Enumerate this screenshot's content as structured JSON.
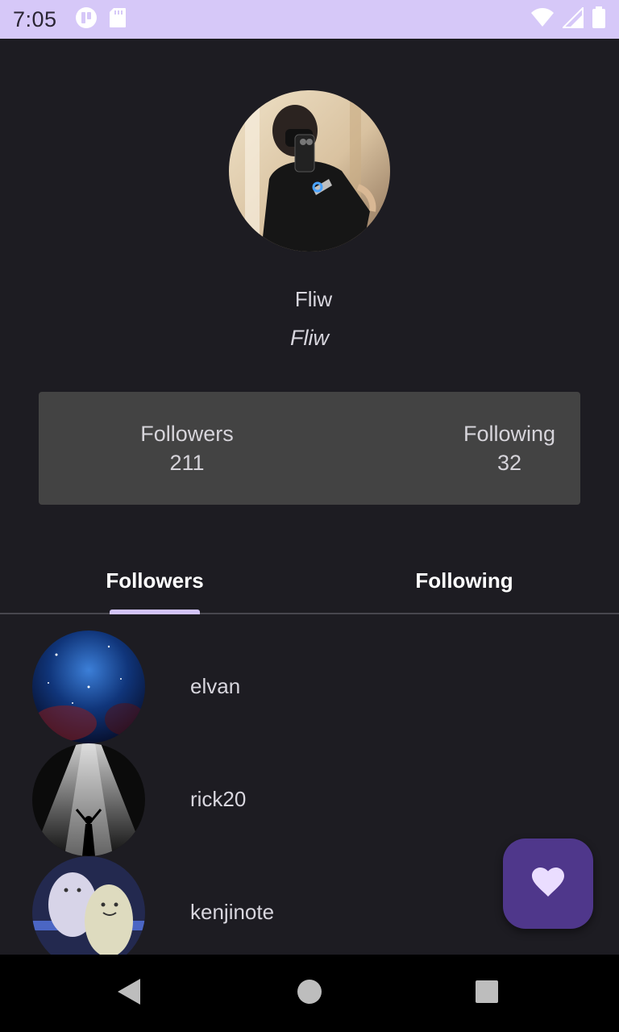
{
  "status_bar": {
    "time": "7:05",
    "icons": [
      "app-notification-icon",
      "sd-card-icon",
      "wifi-icon",
      "cell-signal-icon",
      "battery-icon"
    ]
  },
  "profile": {
    "display_name": "Fliw",
    "username": "Fliw"
  },
  "stats": {
    "followers_label": "Followers",
    "followers_count": "211",
    "following_label": "Following",
    "following_count": "32"
  },
  "tabs": [
    {
      "label": "Followers",
      "selected": true
    },
    {
      "label": "Following",
      "selected": false
    }
  ],
  "list": {
    "items": [
      {
        "username": "elvan"
      },
      {
        "username": "rick20"
      },
      {
        "username": "kenjinote"
      }
    ]
  },
  "fab": {
    "icon": "heart-icon"
  },
  "nav_bar": {
    "icons": [
      "back-icon",
      "home-icon",
      "recents-icon"
    ]
  },
  "colors": {
    "background": "#1d1c22",
    "status_bar": "#d6c8f8",
    "card": "#434343",
    "tab_indicator": "#d2c3f8",
    "fab": "#4f378b",
    "fab_icon": "#eaddff"
  }
}
